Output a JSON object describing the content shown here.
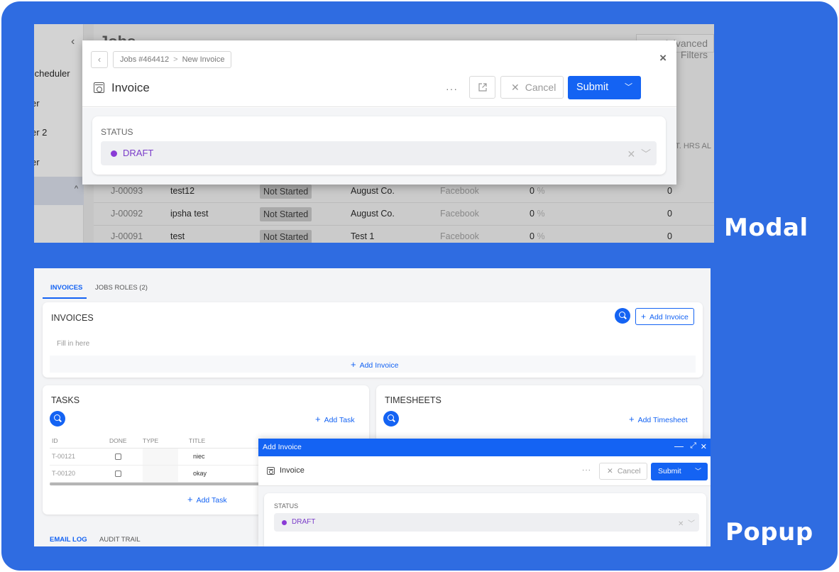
{
  "captions": {
    "modal": "Modal",
    "popup": "Popup"
  },
  "colors": {
    "frame": "#2f6ce1",
    "primary": "#1463f3",
    "status_draft": "#8a3bd6"
  },
  "modal_demo": {
    "background_app": {
      "title": "Jobs",
      "filter_button": "Advanced Filters",
      "sidebar_items": [
        "Scheduler",
        "er",
        "er 2",
        "er"
      ],
      "header_cols": "T. HRS  AL",
      "rows": [
        {
          "id": "J-00093",
          "name": "test12",
          "status": "Not Started",
          "client": "August Co.",
          "source": "Facebook",
          "progress": "0",
          "progress_unit": "%",
          "value": "0"
        },
        {
          "id": "J-00092",
          "name": "ipsha test",
          "status": "Not Started",
          "client": "August Co.",
          "source": "Facebook",
          "progress": "0",
          "progress_unit": "%",
          "value": "0"
        },
        {
          "id": "J-00091",
          "name": "test",
          "status": "Not Started",
          "client": "Test 1",
          "source": "Facebook",
          "progress": "0",
          "progress_unit": "%",
          "value": "0"
        }
      ]
    },
    "modal": {
      "breadcrumb_parent": "Jobs #464412",
      "breadcrumb_separator": ">",
      "breadcrumb_current": "New Invoice",
      "title": "Invoice",
      "more": "···",
      "cancel": "Cancel",
      "submit": "Submit",
      "status_label": "STATUS",
      "status_value": "DRAFT"
    }
  },
  "popup_demo": {
    "tabs": [
      {
        "label": "INVOICES",
        "active": true
      },
      {
        "label": "JOBS ROLES (2)",
        "active": false
      }
    ],
    "invoices": {
      "title": "INVOICES",
      "add_button": "Add Invoice",
      "placeholder": "Fill in here",
      "add_link": "Add Invoice"
    },
    "tasks": {
      "title": "TASKS",
      "add_link": "Add Task",
      "add_bottom": "Add Task",
      "columns": [
        "ID",
        "DONE",
        "TYPE",
        "TITLE"
      ],
      "rows": [
        {
          "id": "T-00121",
          "title": "niec"
        },
        {
          "id": "T-00120",
          "title": "okay"
        }
      ]
    },
    "timesheets": {
      "title": "TIMESHEETS",
      "add_link": "Add Timesheet"
    },
    "bottom_tabs": [
      {
        "label": "EMAIL LOG",
        "active": true
      },
      {
        "label": "AUDIT TRAIL",
        "active": false
      }
    ],
    "popup": {
      "bar_title": "Add Invoice",
      "title": "Invoice",
      "more": "···",
      "cancel": "Cancel",
      "submit": "Submit",
      "status_label": "STATUS",
      "status_value": "DRAFT"
    }
  }
}
